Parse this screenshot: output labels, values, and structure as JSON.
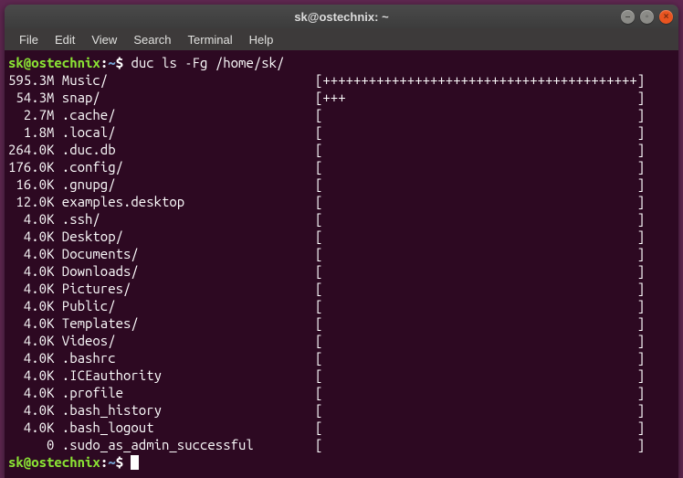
{
  "window": {
    "title": "sk@ostechnix: ~"
  },
  "menu": {
    "file": "File",
    "edit": "Edit",
    "view": "View",
    "search": "Search",
    "terminal": "Terminal",
    "help": "Help"
  },
  "prompt": {
    "user_host": "sk@ostechnix",
    "sep": ":",
    "path": "~",
    "sigil": "$"
  },
  "command": "duc ls -Fg /home/sk/",
  "rows": [
    {
      "size": "595.3M",
      "name": "Music/",
      "bar": "[+++++++++++++++++++++++++++++++++++++++++]"
    },
    {
      "size": " 54.3M",
      "name": "snap/",
      "bar": "[+++                                      ]"
    },
    {
      "size": "  2.7M",
      "name": ".cache/",
      "bar": "[                                         ]"
    },
    {
      "size": "  1.8M",
      "name": ".local/",
      "bar": "[                                         ]"
    },
    {
      "size": "264.0K",
      "name": ".duc.db",
      "bar": "[                                         ]"
    },
    {
      "size": "176.0K",
      "name": ".config/",
      "bar": "[                                         ]"
    },
    {
      "size": " 16.0K",
      "name": ".gnupg/",
      "bar": "[                                         ]"
    },
    {
      "size": " 12.0K",
      "name": "examples.desktop",
      "bar": "[                                         ]"
    },
    {
      "size": "  4.0K",
      "name": ".ssh/",
      "bar": "[                                         ]"
    },
    {
      "size": "  4.0K",
      "name": "Desktop/",
      "bar": "[                                         ]"
    },
    {
      "size": "  4.0K",
      "name": "Documents/",
      "bar": "[                                         ]"
    },
    {
      "size": "  4.0K",
      "name": "Downloads/",
      "bar": "[                                         ]"
    },
    {
      "size": "  4.0K",
      "name": "Pictures/",
      "bar": "[                                         ]"
    },
    {
      "size": "  4.0K",
      "name": "Public/",
      "bar": "[                                         ]"
    },
    {
      "size": "  4.0K",
      "name": "Templates/",
      "bar": "[                                         ]"
    },
    {
      "size": "  4.0K",
      "name": "Videos/",
      "bar": "[                                         ]"
    },
    {
      "size": "  4.0K",
      "name": ".bashrc",
      "bar": "[                                         ]"
    },
    {
      "size": "  4.0K",
      "name": ".ICEauthority",
      "bar": "[                                         ]"
    },
    {
      "size": "  4.0K",
      "name": ".profile",
      "bar": "[                                         ]"
    },
    {
      "size": "  4.0K",
      "name": ".bash_history",
      "bar": "[                                         ]"
    },
    {
      "size": "  4.0K",
      "name": ".bash_logout",
      "bar": "[                                         ]"
    },
    {
      "size": "     0",
      "name": ".sudo_as_admin_successful",
      "bar": "[                                         ]"
    }
  ]
}
